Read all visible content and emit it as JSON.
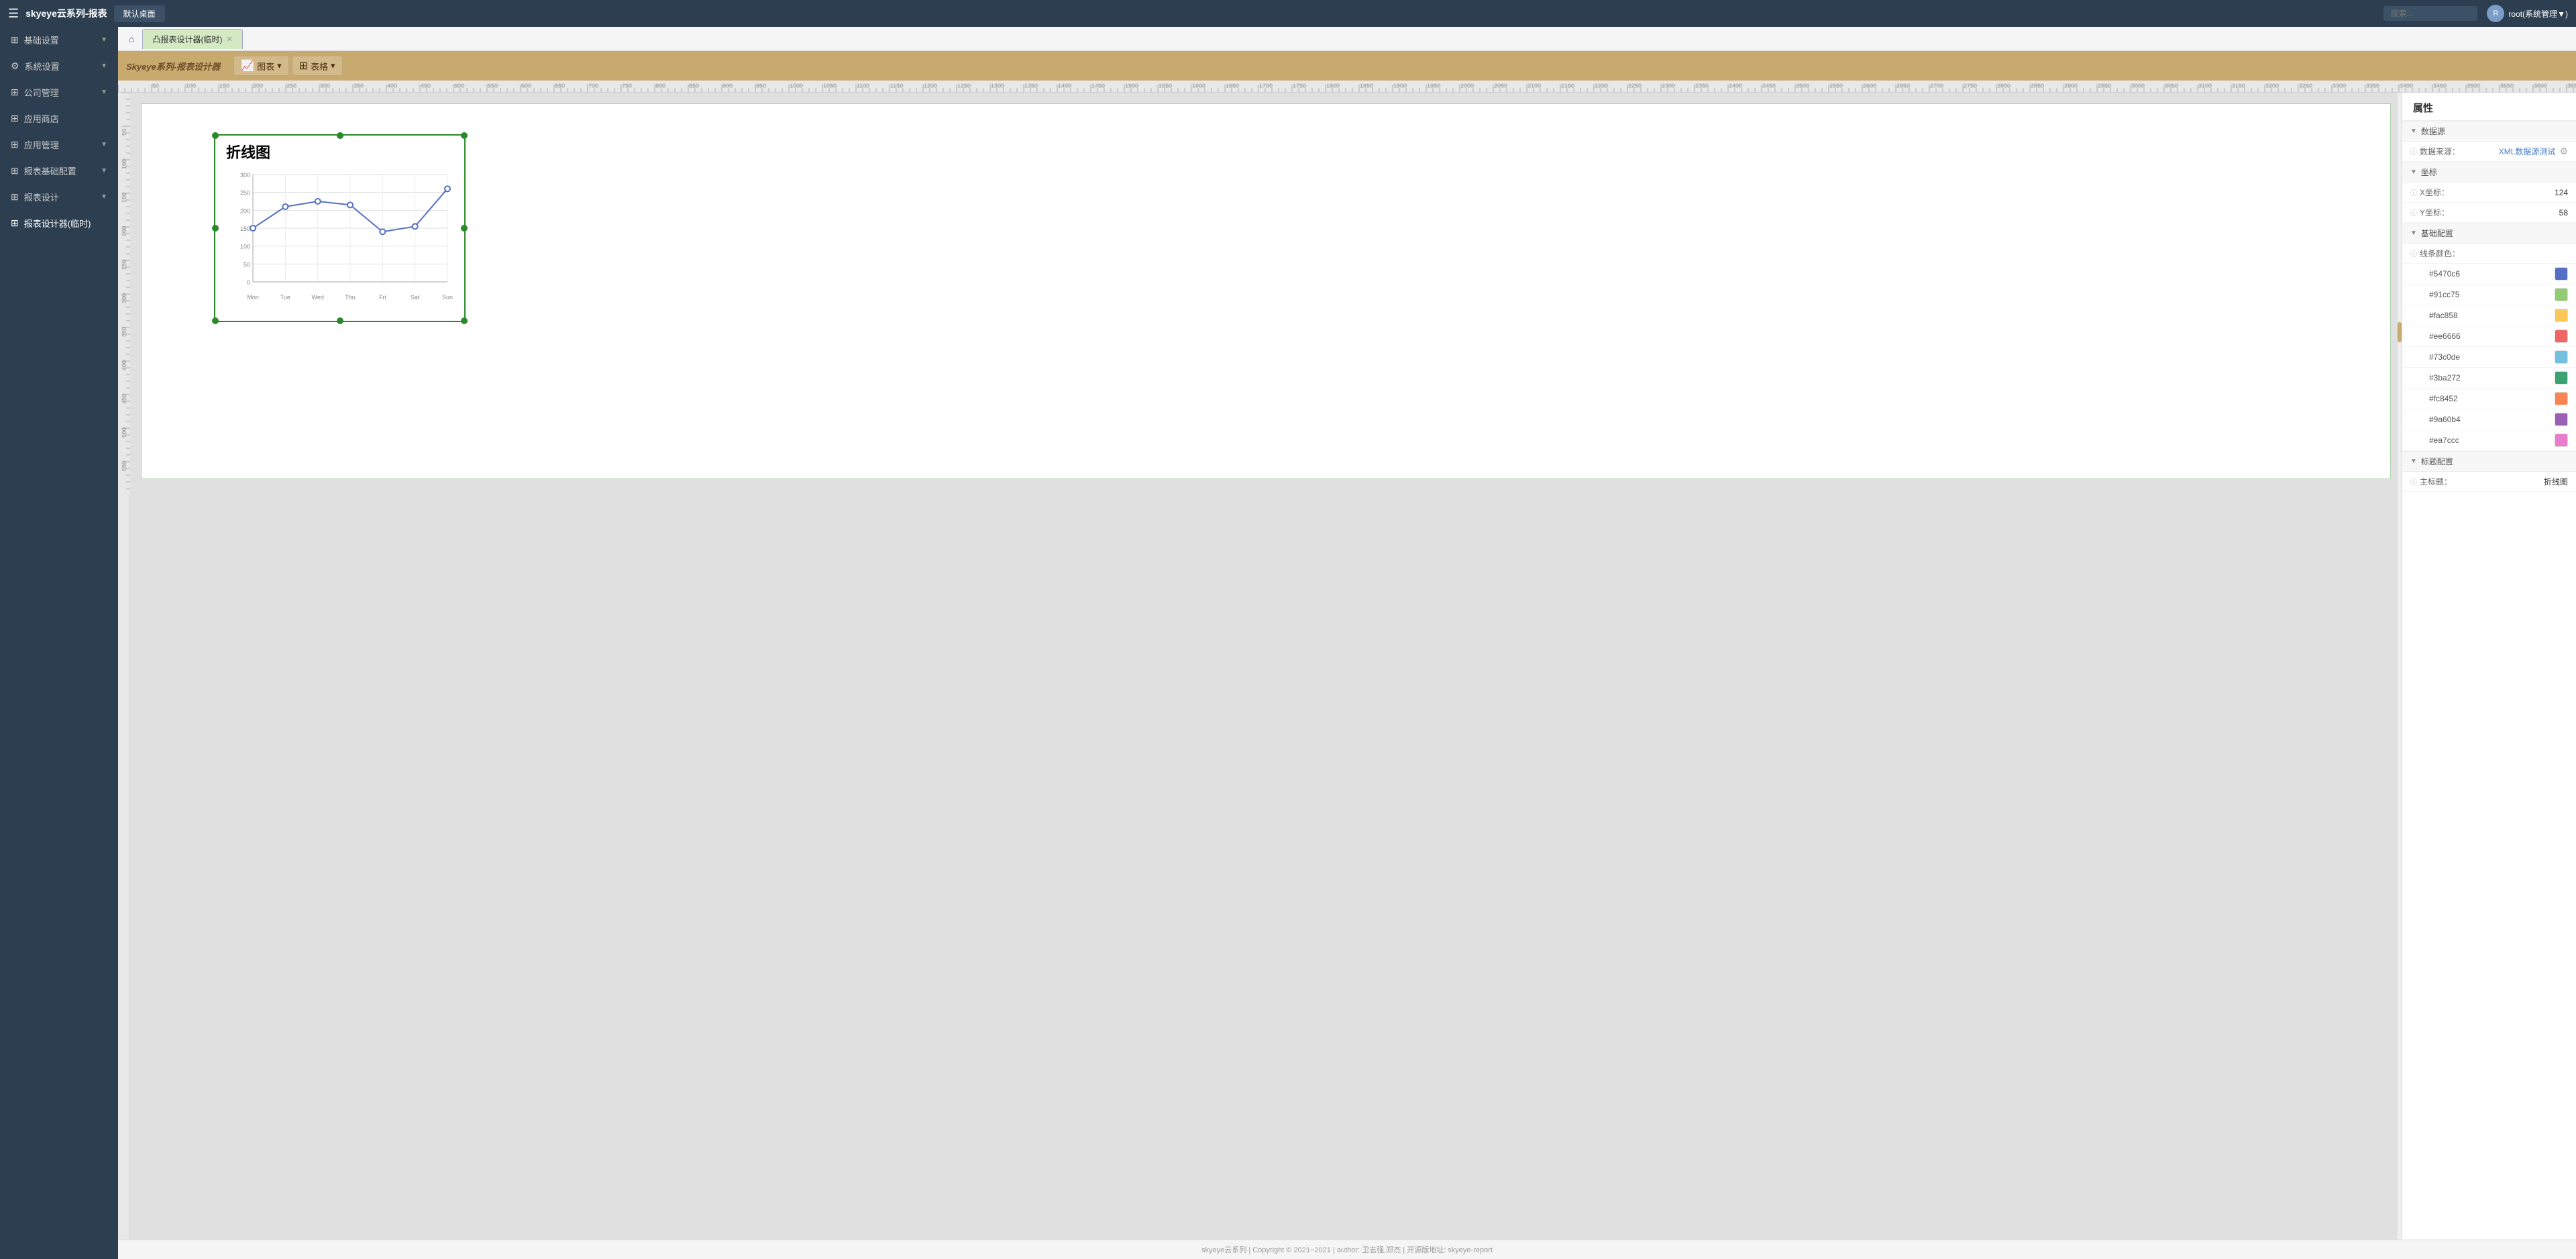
{
  "header": {
    "title": "skyeye云系列-报表",
    "hamburger": "☰",
    "default_tab": "默认桌面",
    "search_placeholder": "搜索...",
    "user_name": "root(系统管理▼)",
    "avatar_text": "R"
  },
  "sidebar": {
    "items": [
      {
        "id": "basic-settings",
        "label": "基础设置",
        "icon": "⊞",
        "has_arrow": true
      },
      {
        "id": "system-settings",
        "label": "系统设置",
        "icon": "⚙",
        "has_arrow": true
      },
      {
        "id": "company-mgmt",
        "label": "公司管理",
        "icon": "⊞",
        "has_arrow": true
      },
      {
        "id": "app-store",
        "label": "应用商店",
        "icon": "⊞",
        "has_arrow": false
      },
      {
        "id": "app-mgmt",
        "label": "应用管理",
        "icon": "⊞",
        "has_arrow": true
      },
      {
        "id": "report-basic-config",
        "label": "报表基础配置",
        "icon": "⊞",
        "has_arrow": true
      },
      {
        "id": "report-design",
        "label": "报表设计",
        "icon": "⊞",
        "has_arrow": true
      },
      {
        "id": "report-designer-temp",
        "label": "报表设计器(临时)",
        "icon": "⊞",
        "has_arrow": false
      }
    ]
  },
  "tabs": {
    "home_icon": "⌂",
    "items": [
      {
        "id": "designer-temp",
        "label": "凸报表设计器(临时)",
        "active": true,
        "closable": true
      }
    ]
  },
  "toolbar": {
    "logo": "Skyeye系列-报表设计器",
    "chart_btn_label": "图表",
    "chart_btn_icon": "📈",
    "table_btn_label": "表格",
    "table_btn_icon": "⊞"
  },
  "chart": {
    "title": "折线图",
    "x_labels": [
      "Mon",
      "Tue",
      "Wed",
      "Thu",
      "Fri",
      "Sat",
      "Sun"
    ],
    "y_labels": [
      "0",
      "50",
      "100",
      "150",
      "200",
      "250",
      "300"
    ],
    "data_points": [
      150,
      210,
      225,
      215,
      140,
      155,
      260
    ],
    "y_min": 0,
    "y_max": 300
  },
  "properties": {
    "title": "属性",
    "sections": {
      "datasource": {
        "label": "数据源",
        "fields": [
          {
            "label": "数据来源:",
            "value": "XML数据源测试",
            "info": true
          }
        ]
      },
      "coordinates": {
        "label": "坐标",
        "fields": [
          {
            "label": "X坐标:",
            "value": "124",
            "info": true
          },
          {
            "label": "Y坐标:",
            "value": "58",
            "info": true
          }
        ]
      },
      "basic_config": {
        "label": "基础配置",
        "line_color_label": "线条颜色:",
        "colors": [
          {
            "value": "#5470c6",
            "hex": "#5470c6"
          },
          {
            "value": "#91cc75",
            "hex": "#91cc75"
          },
          {
            "value": "#fac858",
            "hex": "#fac858"
          },
          {
            "value": "#ee6666",
            "hex": "#ee6666"
          },
          {
            "value": "#73c0de",
            "hex": "#73c0de"
          },
          {
            "value": "#3ba272",
            "hex": "#3ba272"
          },
          {
            "value": "#fc8452",
            "hex": "#fc8452"
          },
          {
            "value": "#9a60b4",
            "hex": "#9a60b4"
          },
          {
            "value": "#ea7ccc",
            "hex": "#ea7ccc"
          }
        ]
      },
      "title_config": {
        "label": "标题配置",
        "fields": [
          {
            "label": "主标题:",
            "value": "折线图",
            "info": true
          }
        ]
      }
    }
  },
  "footer": {
    "text": "skyeye云系列 | Copyright © 2021~2021 | author: 卫志强,郑杰 | 开源版地址: skyeye-report"
  }
}
